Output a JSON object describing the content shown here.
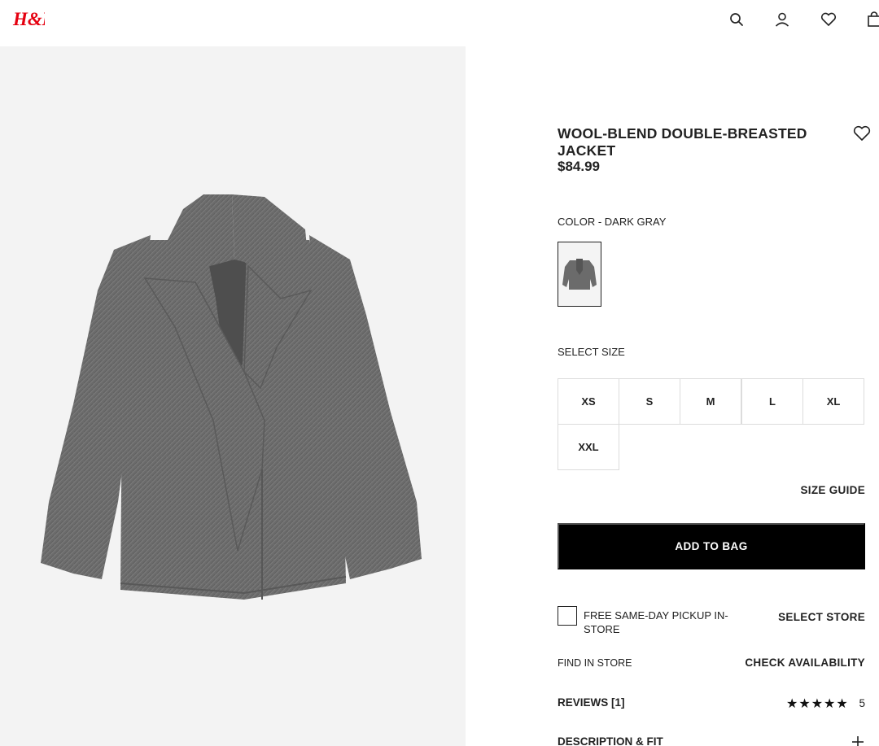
{
  "header": {
    "logo_text": "H&M",
    "icons": [
      "search-icon",
      "account-icon",
      "favorites-icon",
      "shopping-bag-icon"
    ]
  },
  "product": {
    "title": "WOOL-BLEND DOUBLE-BREASTED JACKET",
    "price": "$84.99",
    "color_label": "COLOR - DARK GRAY",
    "size_label": "SELECT SIZE",
    "sizes": [
      "XS",
      "S",
      "M",
      "L",
      "XL",
      "XXL"
    ],
    "size_guide": "SIZE GUIDE",
    "add_to_bag": "ADD TO BAG",
    "pickup_text": "FREE SAME-DAY PICKUP IN-STORE",
    "select_store": "SELECT STORE",
    "find_in_store": "FIND IN STORE",
    "check_availability": "CHECK AVAILABILITY",
    "reviews_label": "REVIEWS [1]",
    "rating_stars": "★★★★★",
    "rating_value": "5",
    "description_label": "DESCRIPTION & FIT"
  },
  "colors": {
    "brand_red": "#e50010",
    "jacket_gray": "#6a6a6a",
    "button_black": "#000000"
  }
}
